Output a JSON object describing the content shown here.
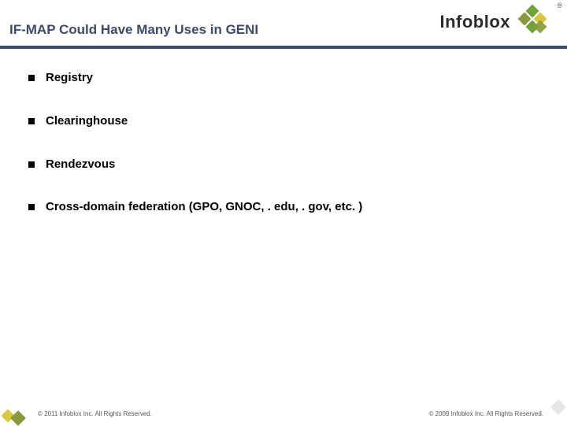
{
  "header": {
    "title": "IF-MAP Could Have Many Uses in GENI",
    "logo_text": "Infoblox",
    "registered_mark": "®"
  },
  "bullets": [
    {
      "text": "Registry"
    },
    {
      "text": "Clearinghouse"
    },
    {
      "text": "Rendezvous"
    },
    {
      "text": "Cross-domain federation (GPO, GNOC, . edu, . gov, etc. )"
    }
  ],
  "footer": {
    "left": "© 2011 Infoblox Inc. All Rights Reserved.",
    "right": "© 2009 Infoblox Inc. All Rights Reserved."
  },
  "colors": {
    "title_color": "#3e4a6a",
    "rule_color": "#3e4a6a",
    "diamond_green": "#6ea33a",
    "diamond_olive": "#8a9a3a",
    "diamond_yellow": "#d8c93c"
  }
}
